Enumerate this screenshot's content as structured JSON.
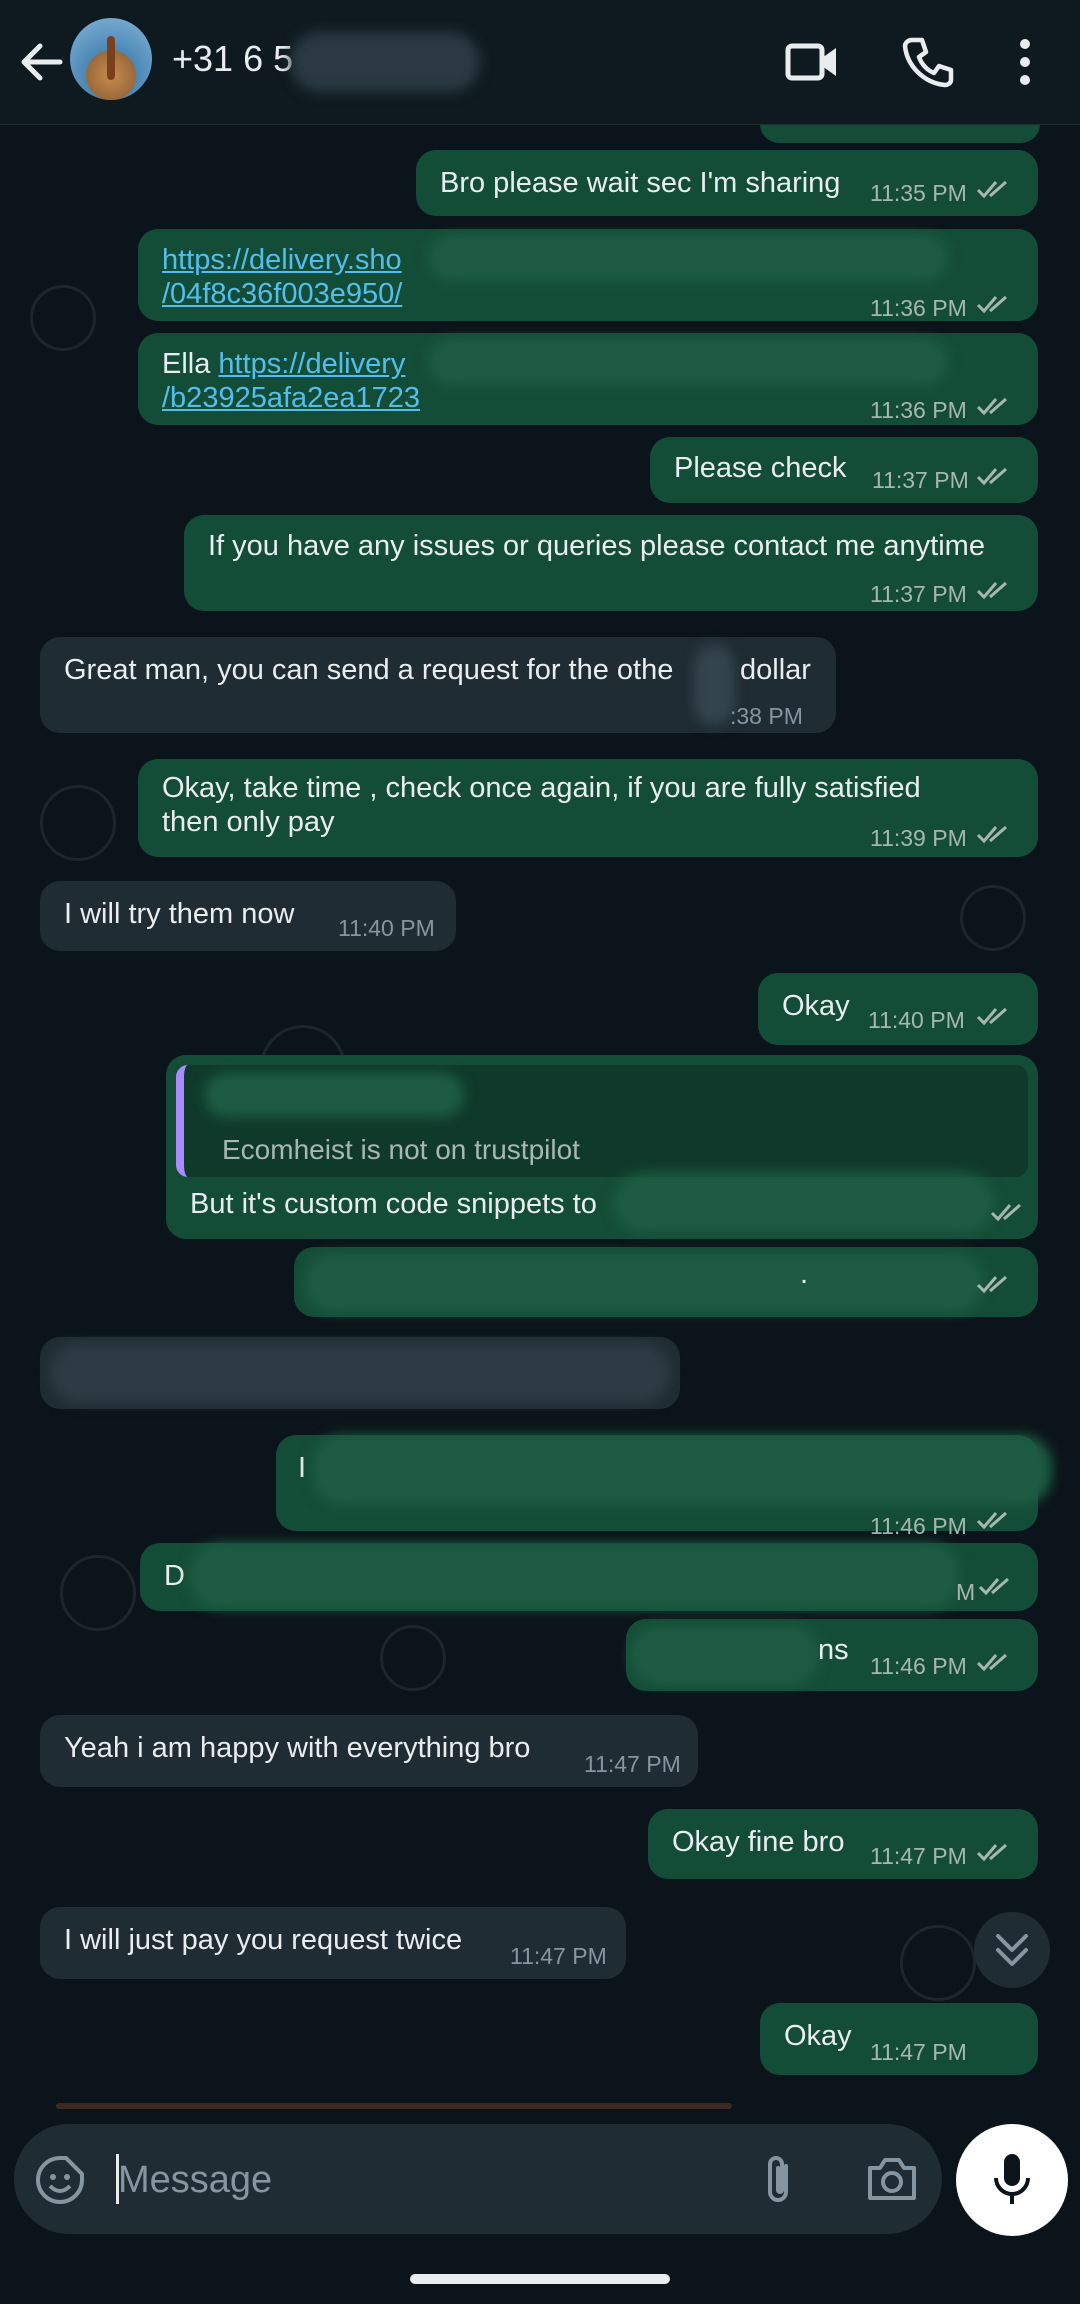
{
  "header": {
    "contact_name": "+31 6 5",
    "back_icon": "arrow-left-icon",
    "video_icon": "video-call-icon",
    "call_icon": "phone-icon",
    "menu_icon": "more-vertical-icon"
  },
  "messages": [
    {
      "dir": "out",
      "text": "Bro please wait sec I'm sharing",
      "time": "11:35 PM"
    },
    {
      "dir": "out",
      "link": "https://delivery.sho",
      "link2": "/04f8c36f003e950/",
      "time": "11:36 PM"
    },
    {
      "dir": "out",
      "prefix": "Ella ",
      "link": "https://delivery",
      "link2": "/b23925afa2ea1723",
      "time": "11:36 PM"
    },
    {
      "dir": "out",
      "text": "Please check",
      "time": "11:37 PM"
    },
    {
      "dir": "out",
      "text": "If you have any issues or queries please contact me anytime",
      "time": "11:37 PM"
    },
    {
      "dir": "in",
      "text": "Great man, you can send a request for the othe",
      "text2": "dollar",
      "time": ":38 PM"
    },
    {
      "dir": "out",
      "text": "Okay, take time , check once again, if you are fully satisfied",
      "text2": "then only pay",
      "time": "11:39 PM"
    },
    {
      "dir": "in",
      "text": "I will try them now",
      "time": "11:40 PM"
    },
    {
      "dir": "out",
      "text": "Okay",
      "time": "11:40 PM"
    },
    {
      "dir": "out",
      "quote": "Ecomheist is not on trustpilot",
      "text": "But it's custom code snippets to",
      "time": ""
    },
    {
      "dir": "out",
      "text": ".",
      "time": ""
    },
    {
      "dir": "in",
      "text": "",
      "time": ""
    },
    {
      "dir": "out",
      "text": "I",
      "time": "11:46 PM"
    },
    {
      "dir": "out",
      "text": "D",
      "time": "M"
    },
    {
      "dir": "out",
      "text": "ns",
      "time": "11:46 PM"
    },
    {
      "dir": "in",
      "text": "Yeah i am happy with everything bro",
      "time": "11:47 PM"
    },
    {
      "dir": "out",
      "text": "Okay fine bro",
      "time": "11:47 PM"
    },
    {
      "dir": "in",
      "text": "I will just pay you request twice",
      "time": "11:47 PM"
    },
    {
      "dir": "out",
      "text": "Okay",
      "time": "11:47 PM"
    }
  ],
  "composer": {
    "placeholder": "Message",
    "emoji_icon": "sticker-icon",
    "attach_icon": "paperclip-icon",
    "camera_icon": "camera-icon",
    "mic_icon": "microphone-icon"
  },
  "scroll_button_icon": "chevron-double-down-icon"
}
